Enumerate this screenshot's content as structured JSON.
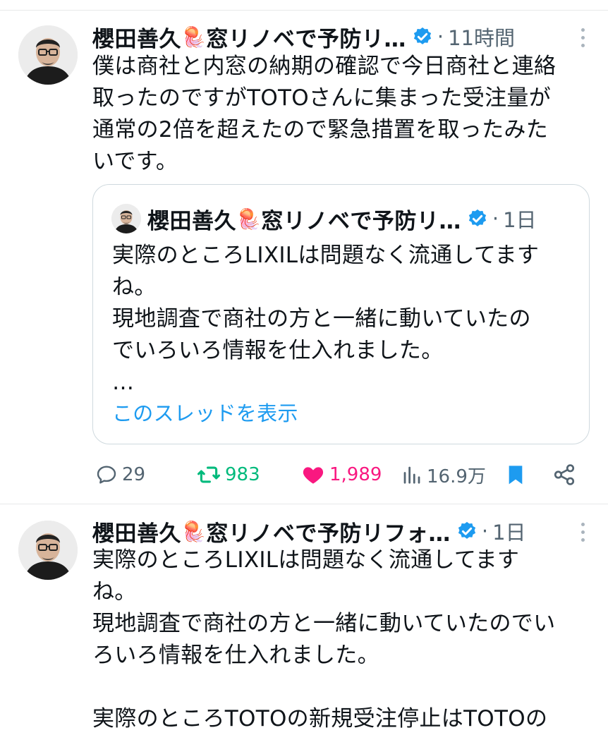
{
  "tweet1": {
    "author": "櫻田善久",
    "emoji": "🪼",
    "handle_text": "窓リノベで予防リ…",
    "separator": "·",
    "time": "11時間",
    "body": "僕は商社と内窓の納期の確認で今日商社と連絡\n取ったのですがTOTOさんに集まった受注量が\n通常の2倍を超えたので緊急措置を取ったみた\nいです。",
    "quote": {
      "author": "櫻田善久",
      "emoji": "🪼",
      "handle_text": "窓リノベで予防リ…",
      "separator": "·",
      "time": "1日",
      "body": "実際のところLIXILは問題なく流通してます\nね。\n現地調査で商社の方と一緒に動いていたの\nでいろいろ情報を仕入れました。\n…",
      "show_thread": "このスレッドを表示"
    },
    "actions": {
      "reply_count": "29",
      "retweet_count": "983",
      "like_count": "1,989",
      "views_count": "16.9万"
    },
    "colors": {
      "retweet": "#00ba7c",
      "like": "#f91880",
      "bookmark": "#1d9bf0",
      "verified": "#1d9bf0"
    }
  },
  "tweet2": {
    "author": "櫻田善久",
    "emoji": "🪼",
    "handle_text": "窓リノベで予防リフォ…",
    "separator": "·",
    "time": "1日",
    "body": "実際のところLIXILは問題なく流通してます\nね。\n現地調査で商社の方と一緒に動いていたのでい\nろいろ情報を仕入れました。\n\n実際のところTOTOの新規受注停止はTOTOの"
  }
}
